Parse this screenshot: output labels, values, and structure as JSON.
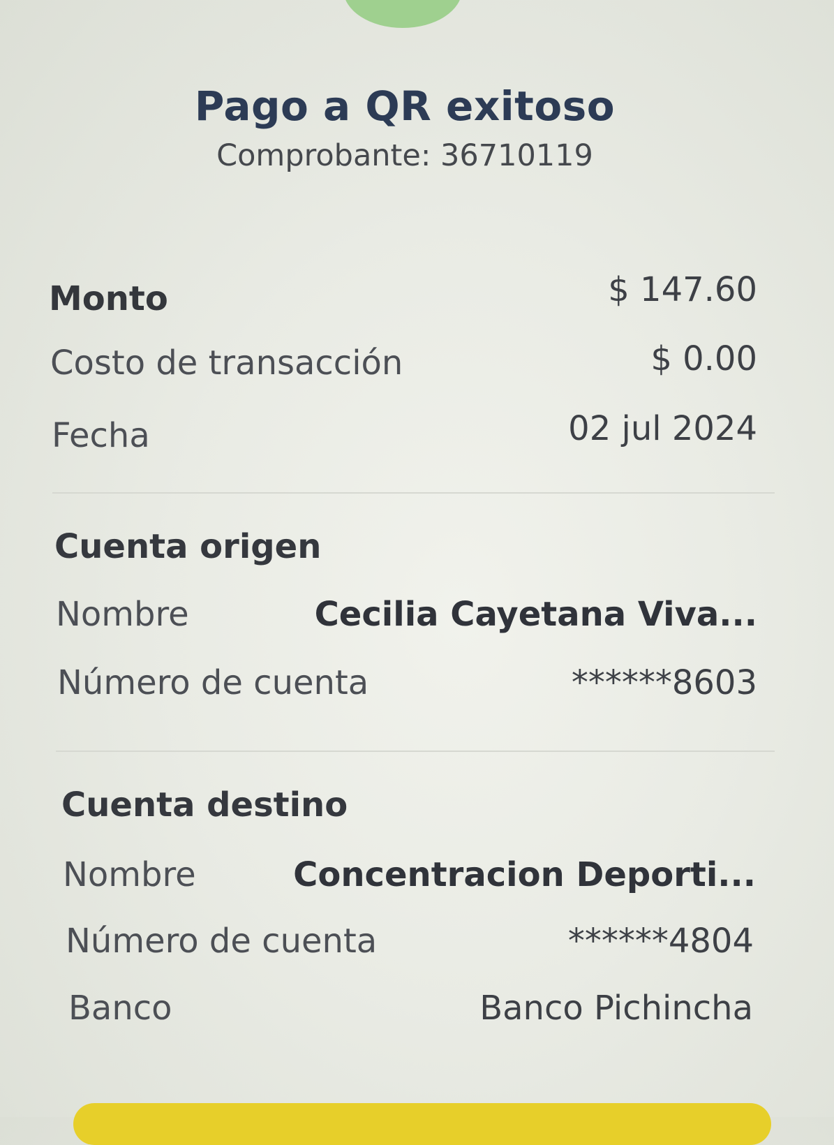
{
  "header": {
    "title": "Pago a QR exitoso",
    "receipt": "Comprobante: 36710119"
  },
  "summary": {
    "amount_label": "Monto",
    "amount_value": "$ 147.60",
    "fee_label": "Costo de transacción",
    "fee_value": "$ 0.00",
    "date_label": "Fecha",
    "date_value": "02 jul 2024"
  },
  "origin": {
    "section_title": "Cuenta origen",
    "name_label": "Nombre",
    "name_value": "Cecilia Cayetana Viva...",
    "account_label": "Número de cuenta",
    "account_value": "******8603"
  },
  "destination": {
    "section_title": "Cuenta destino",
    "name_label": "Nombre",
    "name_value": "Concentracion Deporti...",
    "account_label": "Número de cuenta",
    "account_value": "******4804",
    "bank_label": "Banco",
    "bank_value": "Banco Pichincha"
  },
  "colors": {
    "title": "#2c3b55",
    "success_accent": "#9fd08f",
    "primary_button": "#e7cf2a"
  }
}
